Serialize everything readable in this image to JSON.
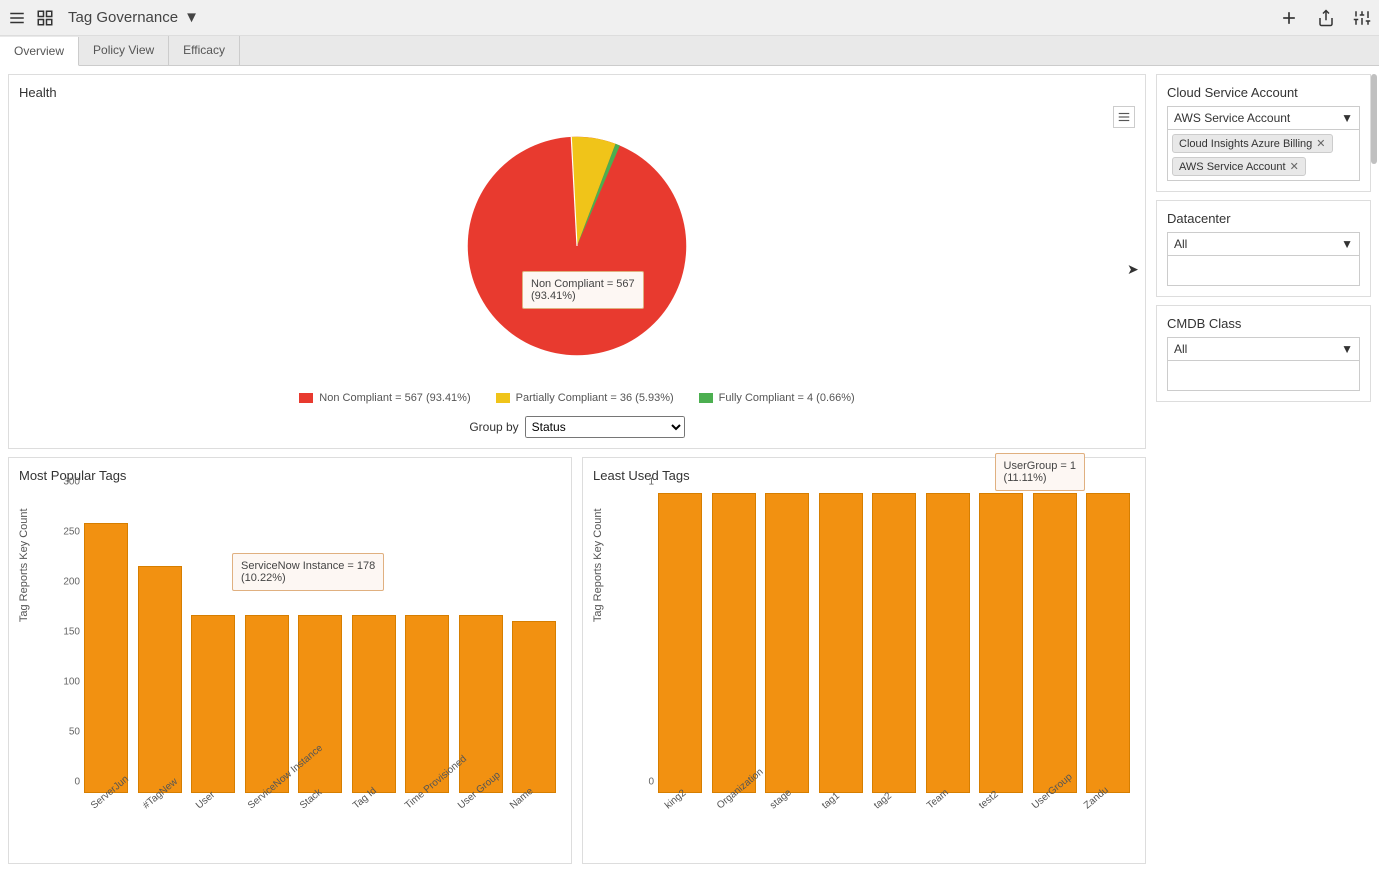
{
  "header": {
    "title": "Tag Governance"
  },
  "tabs": [
    "Overview",
    "Policy View",
    "Efficacy"
  ],
  "health": {
    "title": "Health",
    "tooltip_line1": "Non Compliant = 567",
    "tooltip_line2": "(93.41%)",
    "legend": [
      {
        "label": "Non Compliant = 567 (93.41%)",
        "color": "#e83a2f"
      },
      {
        "label": "Partially Compliant = 36 (5.93%)",
        "color": "#f0c419"
      },
      {
        "label": "Fully Compliant = 4 (0.66%)",
        "color": "#4caf50"
      }
    ],
    "groupby_label": "Group by",
    "groupby_value": "Status"
  },
  "popular": {
    "title": "Most Popular Tags",
    "y_label": "Tag Reports Key Count",
    "tooltip_line1": "ServiceNow Instance = 178",
    "tooltip_line2": "(10.22%)"
  },
  "least": {
    "title": "Least Used Tags",
    "y_label": "Tag Reports Key Count",
    "tooltip_line1": "UserGroup = 1",
    "tooltip_line2": "(11.11%)"
  },
  "filters": {
    "csa": {
      "title": "Cloud Service Account",
      "selected": "AWS Service Account",
      "chips": [
        "Cloud Insights Azure Billing",
        "AWS Service Account"
      ]
    },
    "dc": {
      "title": "Datacenter",
      "selected": "All"
    },
    "cmdb": {
      "title": "CMDB Class",
      "selected": "All"
    }
  },
  "chart_data": [
    {
      "type": "pie",
      "title": "Health",
      "series": [
        {
          "name": "Non Compliant",
          "value": 567,
          "pct": 93.41,
          "color": "#e83a2f"
        },
        {
          "name": "Partially Compliant",
          "value": 36,
          "pct": 5.93,
          "color": "#f0c419"
        },
        {
          "name": "Fully Compliant",
          "value": 4,
          "pct": 0.66,
          "color": "#4caf50"
        }
      ]
    },
    {
      "type": "bar",
      "title": "Most Popular Tags",
      "ylabel": "Tag Reports Key Count",
      "ylim": [
        0,
        300
      ],
      "yticks": [
        0,
        50,
        100,
        150,
        200,
        250,
        300
      ],
      "categories": [
        "ServerJun",
        "#TagNew",
        "User",
        "ServiceNow Instance",
        "Stack",
        "Tag Id",
        "Time Provisioned",
        "User Group",
        "Name"
      ],
      "values": [
        270,
        227,
        178,
        178,
        178,
        178,
        178,
        178,
        172
      ]
    },
    {
      "type": "bar",
      "title": "Least Used Tags",
      "ylabel": "Tag Reports Key Count",
      "ylim": [
        0,
        1
      ],
      "yticks": [
        0,
        1
      ],
      "categories": [
        "king2",
        "Organization",
        "stage",
        "tag1",
        "tag2",
        "Team",
        "test2",
        "UserGroup",
        "Zandu"
      ],
      "values": [
        1,
        1,
        1,
        1,
        1,
        1,
        1,
        1,
        1
      ]
    }
  ]
}
